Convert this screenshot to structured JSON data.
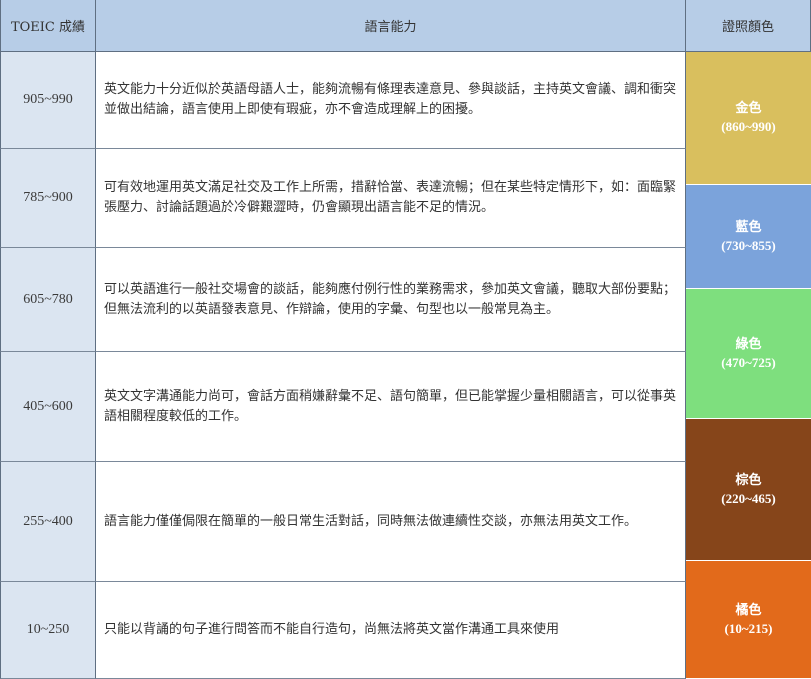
{
  "header": {
    "score_col": "TOEIC 成績",
    "ability_col": "語言能力",
    "cert_col": "證照顏色"
  },
  "rows": [
    {
      "score": "905~990",
      "description": "英文能力十分近似於英語母語人士，能夠流暢有條理表達意見、參與談話，主持英文會議、調和衝突並做出結論，語言使用上即使有瑕疵，亦不會造成理解上的困擾。"
    },
    {
      "score": "785~900",
      "description": "可有效地運用英文滿足社交及工作上所需，措辭恰當、表達流暢；但在某些特定情形下，如：面臨緊張壓力、討論話題過於冷僻艱澀時，仍會顯現出語言能不足的情況。"
    },
    {
      "score": "605~780",
      "description": "可以英語進行一般社交場會的談話，能夠應付例行性的業務需求，參加英文會議，聽取大部份要點；但無法流利的以英語發表意見、作辯論，使用的字彙、句型也以一般常見為主。"
    },
    {
      "score": "405~600",
      "description": "英文文字溝通能力尚可，會話方面稍嫌辭彙不足、語句簡單，但已能掌握少量相關語言，可以從事英語相關程度較低的工作。"
    },
    {
      "score": "255~400",
      "description": "語言能力僅僅侷限在簡單的一般日常生活對話，同時無法做連續性交談，亦無法用英文工作。"
    },
    {
      "score": "10~250",
      "description": "只能以背誦的句子進行問答而不能自行造句，尚無法將英文當作溝通工具來使用"
    }
  ],
  "certificates": [
    {
      "name": "金色",
      "range": "(860~990)",
      "color": "#d9bf5e"
    },
    {
      "name": "藍色",
      "range": "(730~855)",
      "color": "#7ba3db"
    },
    {
      "name": "綠色",
      "range": "(470~725)",
      "color": "#7edf7e"
    },
    {
      "name": "棕色",
      "range": "(220~465)",
      "color": "#86451a"
    },
    {
      "name": "橘色",
      "range": "(10~215)",
      "color": "#e26a1b"
    }
  ]
}
